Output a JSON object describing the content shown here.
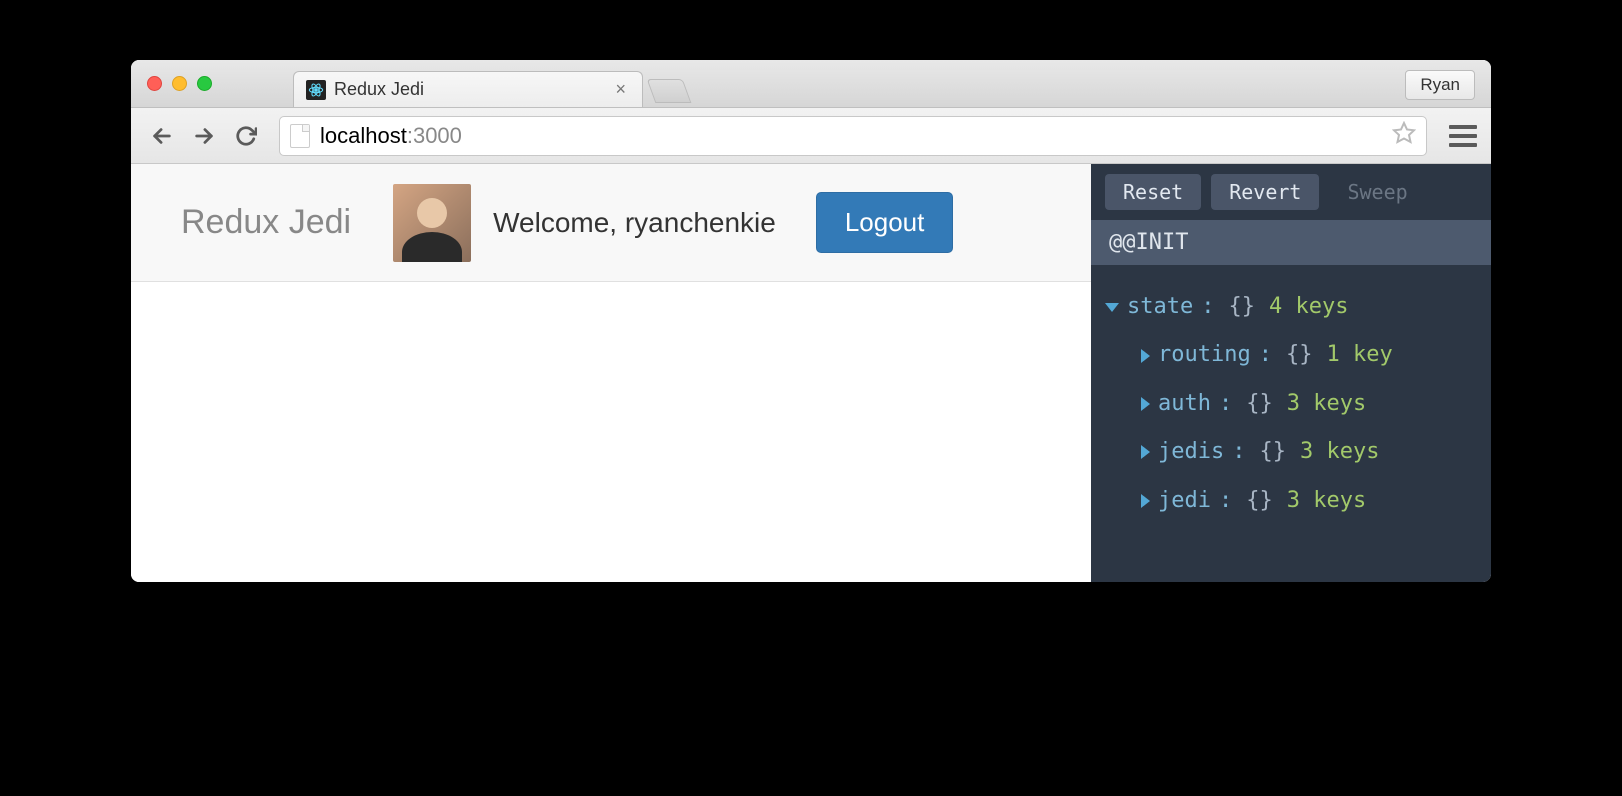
{
  "window": {
    "tab_title": "Redux Jedi",
    "profile_name": "Ryan"
  },
  "address": {
    "host": "localhost",
    "port": ":3000"
  },
  "navbar": {
    "brand": "Redux Jedi",
    "welcome": "Welcome, ryanchenkie",
    "logout_label": "Logout"
  },
  "devtools": {
    "buttons": {
      "reset": "Reset",
      "revert": "Revert",
      "sweep": "Sweep"
    },
    "action": "@@INIT",
    "root": {
      "name": "state",
      "braces": "{}",
      "summary": "4 keys"
    },
    "children": [
      {
        "name": "routing",
        "braces": "{}",
        "summary": "1 key"
      },
      {
        "name": "auth",
        "braces": "{}",
        "summary": "3 keys"
      },
      {
        "name": "jedis",
        "braces": "{}",
        "summary": "3 keys"
      },
      {
        "name": "jedi",
        "braces": "{}",
        "summary": "3 keys"
      }
    ]
  }
}
